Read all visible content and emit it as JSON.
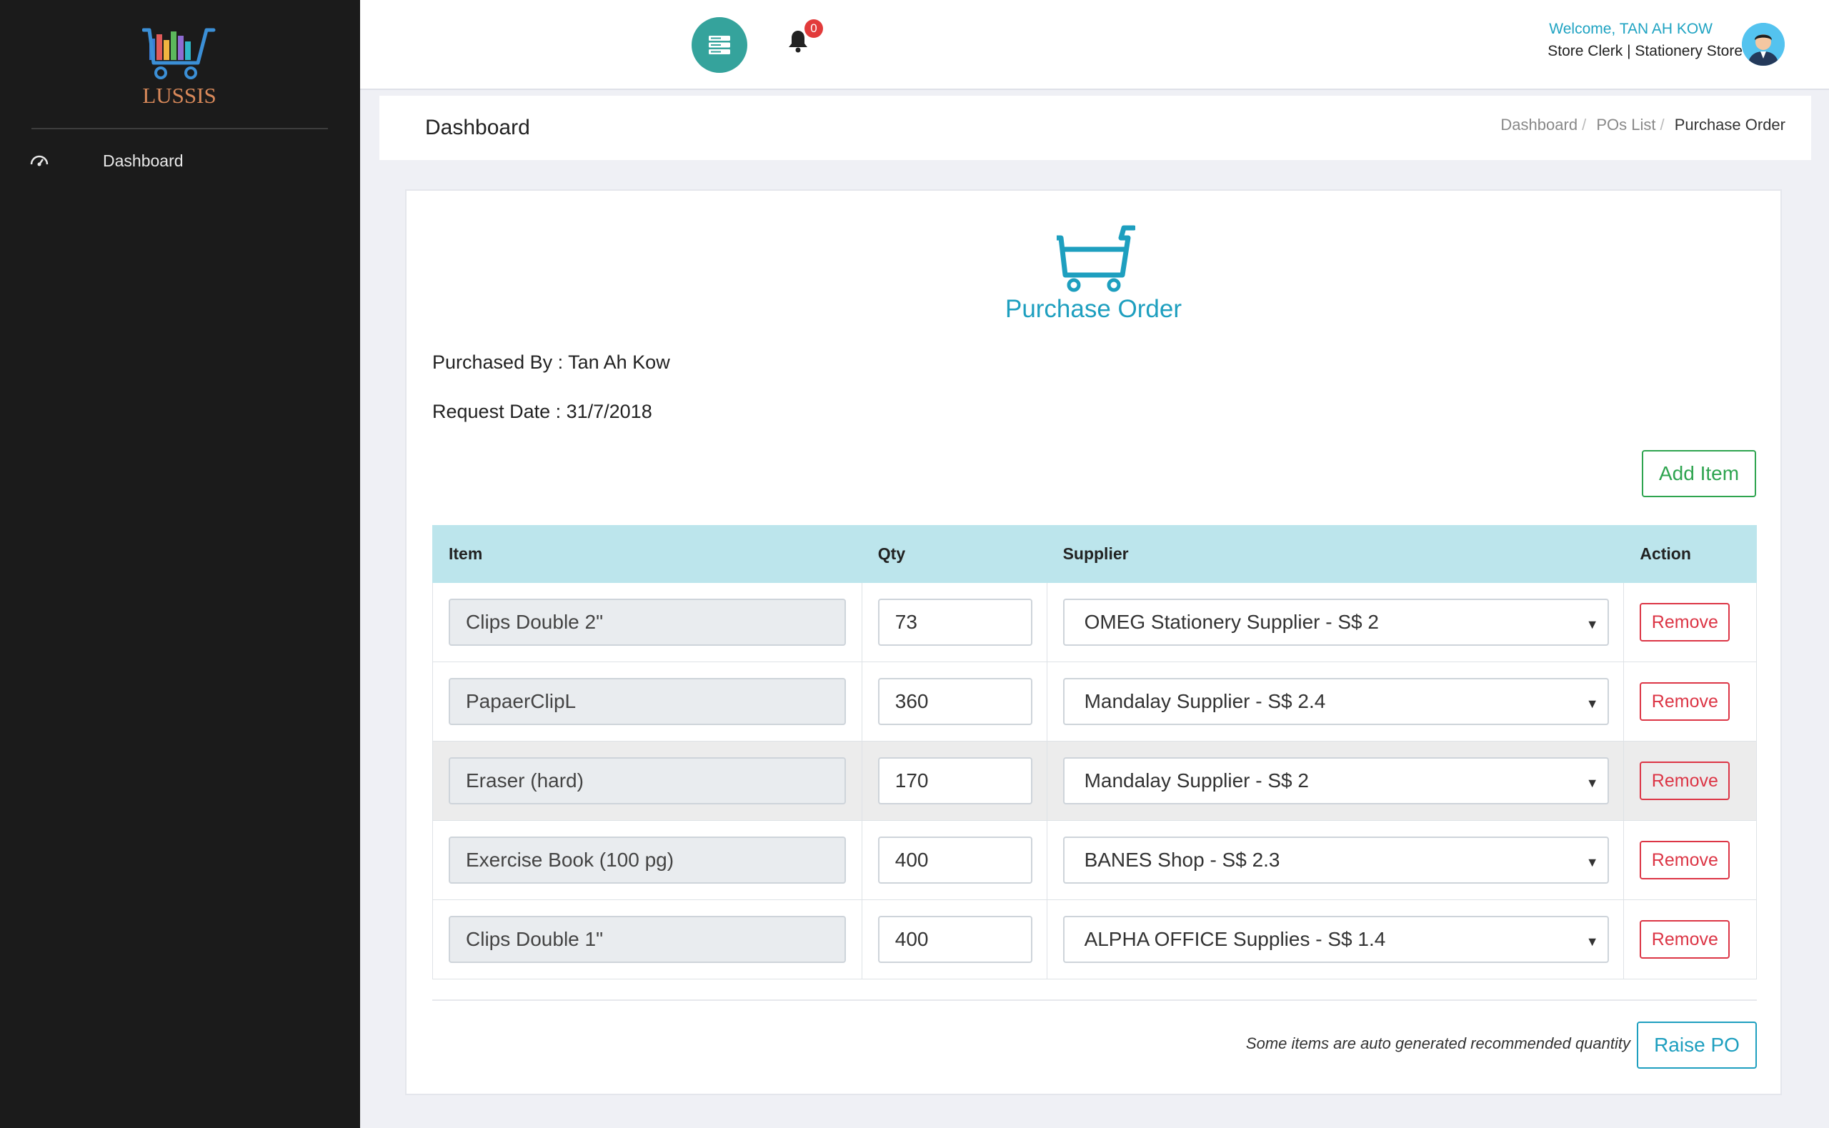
{
  "brand": {
    "name": "LUSSIS"
  },
  "sidebar": {
    "items": [
      {
        "label": "Dashboard",
        "icon": "dashboard-gauge-icon"
      }
    ]
  },
  "topbar": {
    "notifications": {
      "count": "0",
      "icon": "bell-icon"
    },
    "user": {
      "welcome": "Welcome, TAN AH KOW",
      "role": "Store Clerk | Stationery Store"
    }
  },
  "header": {
    "title": "Dashboard",
    "breadcrumb": [
      "Dashboard",
      "POs List",
      "Purchase Order"
    ]
  },
  "po": {
    "title": "Purchase Order",
    "purchased_by": "Purchased By : Tan Ah Kow",
    "request_date": "Request Date : 31/7/2018",
    "add_item_label": "Add Item",
    "columns": [
      "Item",
      "Qty",
      "Supplier",
      "Action"
    ],
    "rows": [
      {
        "item": "Clips Double 2\"",
        "qty": "73",
        "supplier": "OMEG Stationery Supplier - S$ 2",
        "action": "Remove"
      },
      {
        "item": "PapaerClipL",
        "qty": "360",
        "supplier": "Mandalay Supplier - S$ 2.4",
        "action": "Remove"
      },
      {
        "item": "Eraser (hard)",
        "qty": "170",
        "supplier": "Mandalay Supplier - S$ 2",
        "action": "Remove"
      },
      {
        "item": "Exercise Book (100 pg)",
        "qty": "400",
        "supplier": "BANES Shop - S$ 2.3",
        "action": "Remove"
      },
      {
        "item": "Clips Double 1\"",
        "qty": "400",
        "supplier": "ALPHA OFFICE Supplies - S$ 1.4",
        "action": "Remove"
      }
    ],
    "footer_note": "Some items are auto generated recommended quantity",
    "raise_label": "Raise PO"
  },
  "colors": {
    "accent": "#1e9fbf",
    "success": "#2ea44f",
    "danger": "#dc3545",
    "toggle": "#35a39c",
    "sidebar_bg": "#1b1b1b",
    "table_head": "#bce5ec"
  }
}
